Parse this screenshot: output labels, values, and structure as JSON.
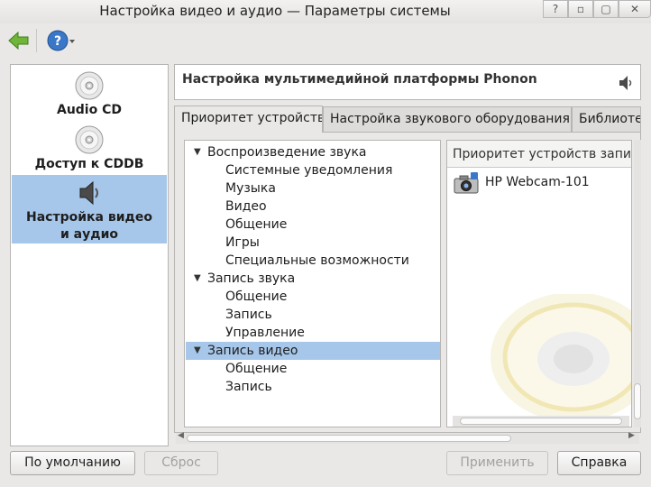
{
  "window": {
    "title": "Настройка видео и аудио — Параметры системы"
  },
  "sidebar": {
    "items": [
      {
        "label": "Audio CD",
        "icon": "cd-icon"
      },
      {
        "label": "Доступ к CDDB",
        "icon": "cd-icon"
      },
      {
        "label_line1": "Настройка видео",
        "label_line2": "и аудио",
        "icon": "speaker-icon",
        "selected": true
      }
    ]
  },
  "header": {
    "title": "Настройка мультимедийной платформы Phonon"
  },
  "tabs": [
    {
      "label": "Приоритет устройств"
    },
    {
      "label": "Настройка звукового оборудования"
    },
    {
      "label": "Библиотеки"
    }
  ],
  "tree": {
    "groups": [
      {
        "label": "Воспроизведение звука",
        "children": [
          "Системные уведомления",
          "Музыка",
          "Видео",
          "Общение",
          "Игры",
          "Специальные возможности"
        ]
      },
      {
        "label": "Запись звука",
        "children": [
          "Общение",
          "Запись",
          "Управление"
        ]
      },
      {
        "label": "Запись видео",
        "children": [
          "Общение",
          "Запись"
        ]
      }
    ]
  },
  "device_panel": {
    "header": "Приоритет устройств записи видео",
    "devices": [
      {
        "name": "HP Webcam-101",
        "icon": "webcam-icon"
      }
    ]
  },
  "buttons": {
    "defaults": "По умолчанию",
    "reset": "Сброс",
    "apply": "Применить",
    "help": "Справка"
  },
  "colors": {
    "selection": "#a6c7ea",
    "window_bg": "#e9e8e6",
    "back_arrow": "#6fb53a",
    "help_icon": "#3a77c8"
  }
}
